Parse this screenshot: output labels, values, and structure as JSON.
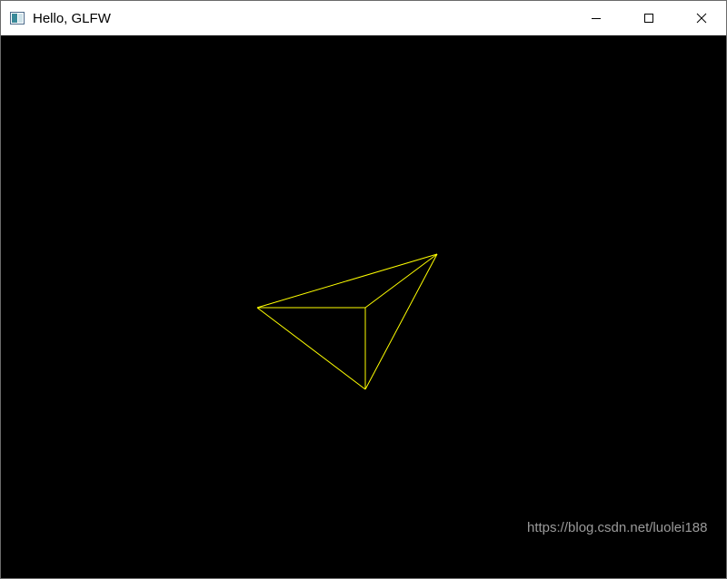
{
  "window": {
    "title": "Hello, GLFW",
    "app_icon": "glfw-window-icon",
    "controls": {
      "minimize_icon": "minimize-icon",
      "maximize_icon": "maximize-icon",
      "close_icon": "close-icon"
    }
  },
  "scene": {
    "background_color": "#000000",
    "wireframe_color": "#ffff00",
    "shape": "pyramid-wireframe"
  },
  "watermark": {
    "text": "https://blog.csdn.net/luolei188"
  }
}
